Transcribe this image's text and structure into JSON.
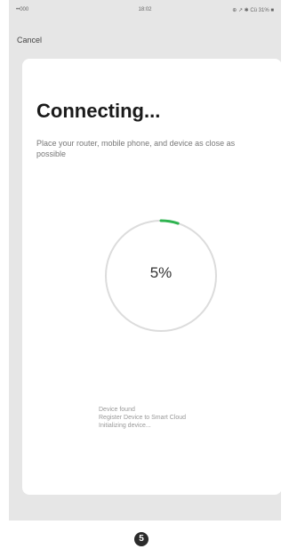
{
  "status_bar": {
    "carrier": "••000",
    "time": "18:02",
    "right": "⊕ ↗ ✱ Cü 31% ■"
  },
  "nav": {
    "cancel_label": "Cancel"
  },
  "card": {
    "title": "Connecting...",
    "subtitle": "Place your router, mobile phone, and device as close as possible"
  },
  "progress": {
    "label": "5%",
    "fraction": 0.05,
    "accent_color": "#2fb350",
    "track_color": "#dcdcdc"
  },
  "status_messages": [
    "Device found",
    "Register Device to Smart Cloud",
    "Initializing device..."
  ],
  "step": {
    "number": "5"
  }
}
